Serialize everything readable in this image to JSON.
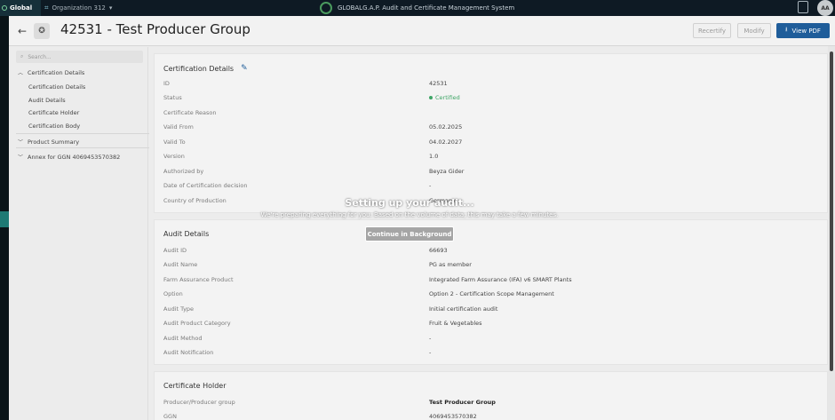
{
  "topbar": {
    "global_label": "Global",
    "org_label": "Organization 312",
    "system_title": "GLOBALG.A.P. Audit and Certificate Management System",
    "avatar_initials": "AA"
  },
  "header": {
    "title": "42531 - Test Producer Group",
    "recertify_label": "Recertify",
    "modify_label": "Modify",
    "view_pdf_label": "View PDF"
  },
  "sidebar": {
    "search_placeholder": "Search...",
    "sections": [
      {
        "label": "Certification Details",
        "children": [
          "Certification Details",
          "Audit Details",
          "Certificate Holder",
          "Certification Body"
        ]
      },
      {
        "label": "Product Summary"
      },
      {
        "label": "Annex for GGN 4069453570382"
      }
    ]
  },
  "certification_details": {
    "title": "Certification Details",
    "rows": [
      {
        "label": "ID",
        "value": "42531"
      },
      {
        "label": "Status",
        "value": "Certified"
      },
      {
        "label": "Certificate Reason",
        "value": ""
      },
      {
        "label": "Valid From",
        "value": "05.02.2025"
      },
      {
        "label": "Valid To",
        "value": "04.02.2027"
      },
      {
        "label": "Version",
        "value": "1.0"
      },
      {
        "label": "Authorized by",
        "value": "Beyza Gider"
      },
      {
        "label": "Date of Certification decision",
        "value": "-"
      },
      {
        "label": "Country of Production",
        "value": "Germany"
      }
    ]
  },
  "audit_details": {
    "title": "Audit Details",
    "rows": [
      {
        "label": "Audit ID",
        "value": "66693"
      },
      {
        "label": "Audit Name",
        "value": "PG as member"
      },
      {
        "label": "Farm Assurance Product",
        "value": "Integrated Farm Assurance (IFA) v6 SMART Plants"
      },
      {
        "label": "Option",
        "value": "Option 2 - Certification Scope Management"
      },
      {
        "label": "Audit Type",
        "value": "Initial certification audit"
      },
      {
        "label": "Audit Product Category",
        "value": "Fruit & Vegetables"
      },
      {
        "label": "Audit Method",
        "value": "-"
      },
      {
        "label": "Audit Notification",
        "value": "-"
      }
    ]
  },
  "certificate_holder": {
    "title": "Certificate Holder",
    "rows": [
      {
        "label": "Producer/Producer group",
        "value": "Test Producer Group"
      },
      {
        "label": "GGN",
        "value": "4069453570382"
      }
    ]
  },
  "overlay": {
    "title": "Setting up your audit...",
    "message": "We're preparing everything for you. Based on the volume of data, this may take a few minutes.",
    "button_label": "Continue in Background"
  },
  "colors": {
    "primary": "#1f5d9a",
    "status_green": "#3fa566",
    "topbar": "#0e1a24"
  }
}
